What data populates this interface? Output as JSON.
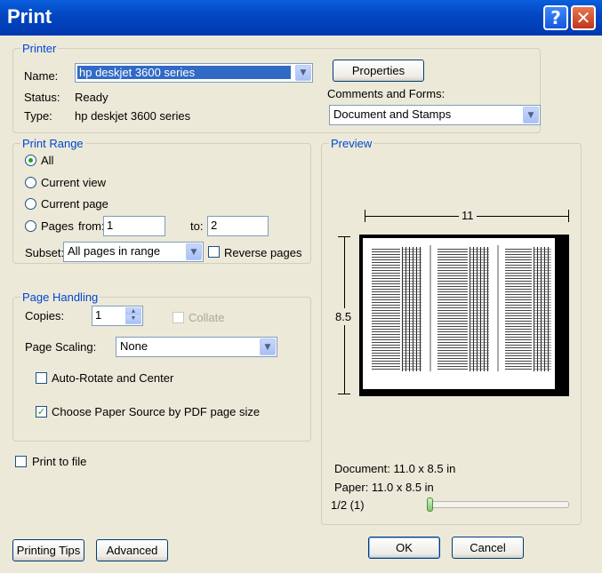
{
  "window": {
    "title": "Print",
    "help_glyph": "?",
    "close_glyph": "✕"
  },
  "printer": {
    "legend": "Printer",
    "name_label": "Name:",
    "name_value": "hp deskjet 3600 series",
    "status_label": "Status:",
    "status_value": "Ready",
    "type_label": "Type:",
    "type_value": "hp deskjet 3600 series",
    "properties_button": "Properties",
    "comments_label": "Comments and Forms:",
    "comments_value": "Document and Stamps"
  },
  "print_range": {
    "legend": "Print Range",
    "options": [
      {
        "label": "All",
        "selected": true
      },
      {
        "label": "Current view",
        "selected": false
      },
      {
        "label": "Current page",
        "selected": false
      },
      {
        "label": "Pages",
        "selected": false
      }
    ],
    "from_label": "from:",
    "from_value": "1",
    "to_label": "to:",
    "to_value": "2",
    "subset_label": "Subset:",
    "subset_value": "All pages in range",
    "reverse_label": "Reverse pages",
    "reverse_checked": false
  },
  "page_handling": {
    "legend": "Page Handling",
    "copies_label": "Copies:",
    "copies_value": "1",
    "collate_label": "Collate",
    "collate_enabled": false,
    "scaling_label": "Page Scaling:",
    "scaling_value": "None",
    "autorotate_label": "Auto-Rotate and Center",
    "autorotate_checked": false,
    "papersource_label": "Choose Paper Source by PDF page size",
    "papersource_checked": true
  },
  "print_to_file": {
    "label": "Print to file",
    "checked": false
  },
  "preview": {
    "legend": "Preview",
    "width_label": "11",
    "height_label": "8.5",
    "document_text": "Document: 11.0 x 8.5 in",
    "paper_text": "Paper: 11.0 x 8.5 in",
    "page_indicator": "1/2 (1)",
    "slider_position": 0
  },
  "buttons": {
    "printing_tips": "Printing Tips",
    "advanced": "Advanced",
    "ok": "OK",
    "cancel": "Cancel"
  }
}
